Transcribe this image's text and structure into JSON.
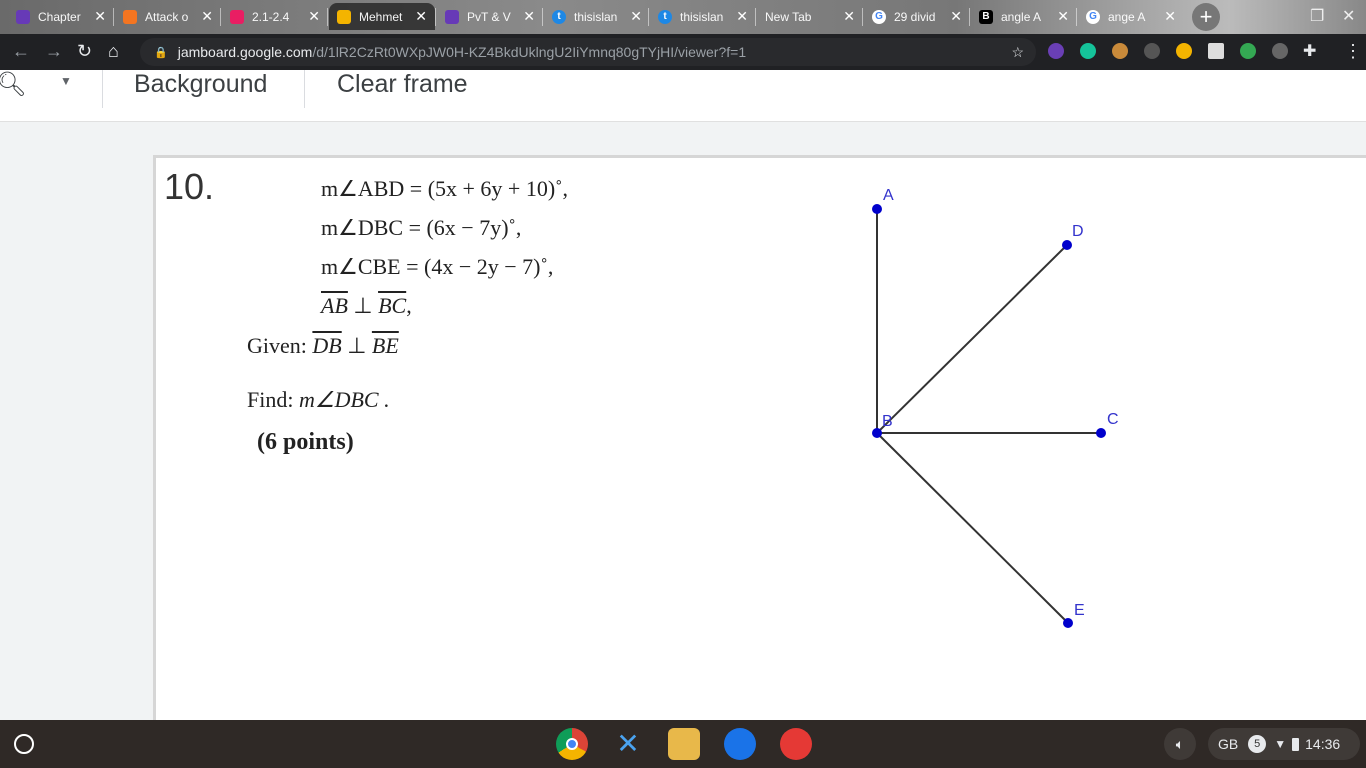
{
  "tabs": [
    {
      "title": "Chapter",
      "icon": "forms-icon",
      "color": "#673ab7"
    },
    {
      "title": "Attack o",
      "icon": "crunchyroll-icon",
      "color": "#f47521"
    },
    {
      "title": "2.1-2.4",
      "icon": "classroom-icon",
      "color": "#e91e63"
    },
    {
      "title": "Mehmet",
      "icon": "music-icon",
      "color": "#f4b400"
    },
    {
      "title": "PvT & V",
      "icon": "forms-icon",
      "color": "#673ab7"
    },
    {
      "title": "thisislan",
      "icon": "t-icon",
      "color": "#1e88e5"
    },
    {
      "title": "thisislan",
      "icon": "t-icon",
      "color": "#1e88e5"
    },
    {
      "title": "New Tab",
      "icon": "",
      "color": ""
    },
    {
      "title": "29 divid",
      "icon": "google-icon",
      "color": "#fff"
    },
    {
      "title": "angle A",
      "icon": "b-icon",
      "color": "#000"
    },
    {
      "title": "ange A",
      "icon": "google-icon",
      "color": "#fff"
    }
  ],
  "address": {
    "host": "jamboard.google.com",
    "path": "/d/1lR2CzRt0WXpJW0H-KZ4BkdUklngU2IiYmnq80gTYjHI/viewer?f=1"
  },
  "toolbar": {
    "background": "Background",
    "clear_frame": "Clear frame"
  },
  "problem": {
    "number": "10.",
    "lines": [
      "m∠ABD = (5x + 6y + 10)˚,",
      "m∠DBC = (6x − 7y)˚,",
      "m∠CBE = (4x − 2y − 7)˚,"
    ],
    "perp1": {
      "a": "AB",
      "b": "BC",
      "suffix": ","
    },
    "given_label": "Given:",
    "perp2": {
      "a": "DB",
      "b": "BE"
    },
    "find_label": "Find:",
    "find": "m∠DBC .",
    "points": "(6 points)"
  },
  "diagram": {
    "labels": {
      "A": "A",
      "B": "B",
      "C": "C",
      "D": "D",
      "E": "E"
    },
    "point_color": "#0000cc",
    "label_color": "#3333cc"
  },
  "tray": {
    "keyboard": "GB",
    "notifications": "5",
    "time": "14:36"
  }
}
